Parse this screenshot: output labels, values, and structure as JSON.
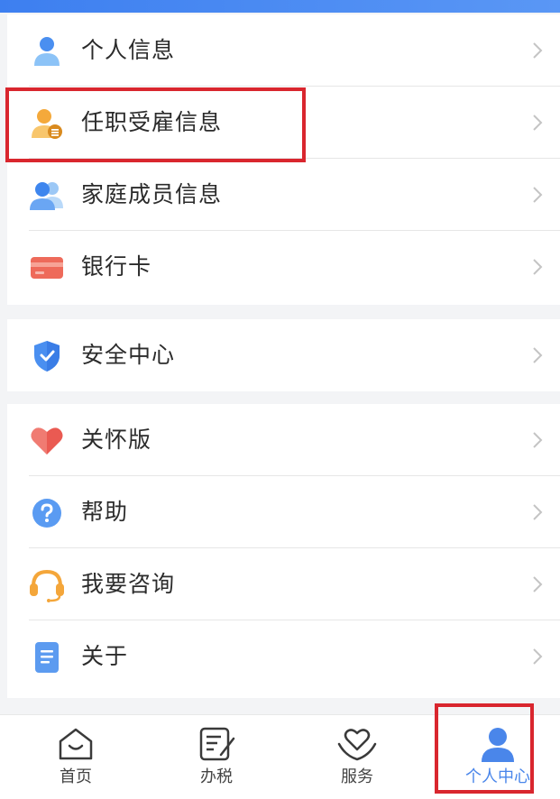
{
  "menu": {
    "group1": [
      {
        "label": "个人信息",
        "icon": "person-icon"
      },
      {
        "label": "任职受雇信息",
        "icon": "employment-icon"
      },
      {
        "label": "家庭成员信息",
        "icon": "family-icon"
      },
      {
        "label": "银行卡",
        "icon": "bank-card-icon"
      }
    ],
    "group2": [
      {
        "label": "安全中心",
        "icon": "shield-icon"
      }
    ],
    "group3": [
      {
        "label": "关怀版",
        "icon": "heart-icon"
      },
      {
        "label": "帮助",
        "icon": "help-icon"
      },
      {
        "label": "我要咨询",
        "icon": "headset-icon"
      },
      {
        "label": "关于",
        "icon": "document-icon"
      }
    ]
  },
  "tabbar": {
    "tabs": [
      {
        "label": "首页",
        "icon": "home-icon"
      },
      {
        "label": "办税",
        "icon": "tax-icon"
      },
      {
        "label": "服务",
        "icon": "service-heart-icon"
      },
      {
        "label": "个人中心",
        "icon": "profile-icon"
      }
    ],
    "active": "个人中心"
  },
  "colors": {
    "accent": "#4a86ea",
    "highlight_box": "#d9262e"
  }
}
